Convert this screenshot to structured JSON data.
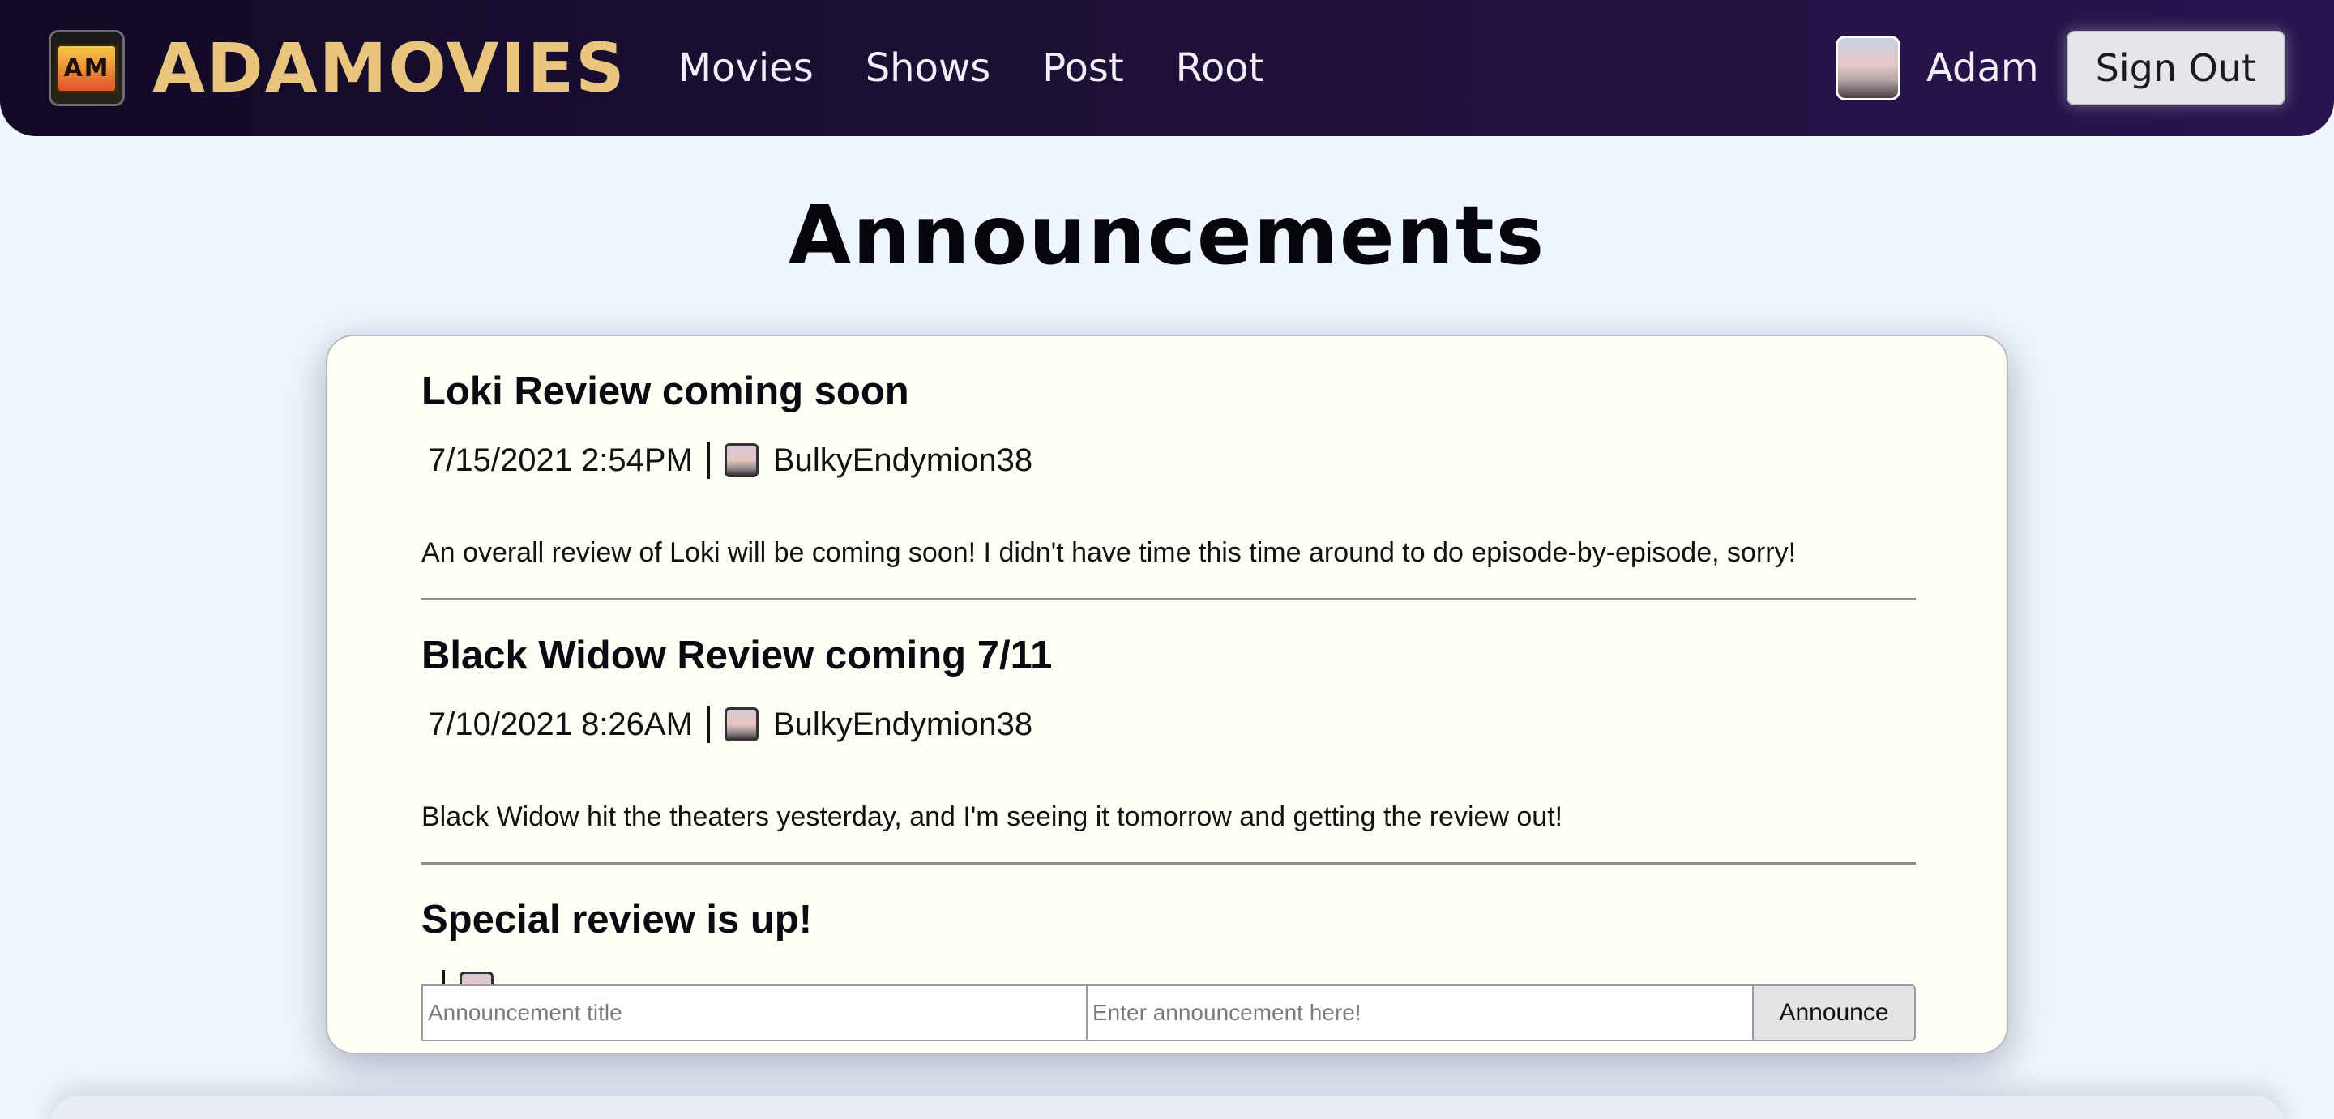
{
  "navbar": {
    "logo_glyph": "AM",
    "brand": "ADAMOVIES",
    "links": [
      "Movies",
      "Shows",
      "Post",
      "Root"
    ],
    "user_name": "Adam",
    "signout_label": "Sign Out"
  },
  "page": {
    "title": "Announcements"
  },
  "announcements": [
    {
      "title": "Loki Review coming soon",
      "date": "7/15/2021 2:54PM",
      "author": "BulkyEndymion38",
      "body": "An overall review of Loki will be coming soon! I didn't have time this time around to do episode-by-episode, sorry!"
    },
    {
      "title": "Black Widow Review coming 7/11",
      "date": "7/10/2021 8:26AM",
      "author": "BulkyEndymion38",
      "body": "Black Widow hit the theaters yesterday, and I'm seeing it tomorrow and getting the review out!"
    },
    {
      "title": "Special review is up!",
      "date": "",
      "author": "",
      "body": ""
    }
  ],
  "compose": {
    "title_placeholder": "Announcement title",
    "body_placeholder": "Enter announcement here!",
    "submit_label": "Announce"
  },
  "colors": {
    "page_bg": "#eff6fe",
    "navbar_dark": "#1d1036",
    "brand_gold": "#e9c57e",
    "card_bg": "#fefef5"
  }
}
